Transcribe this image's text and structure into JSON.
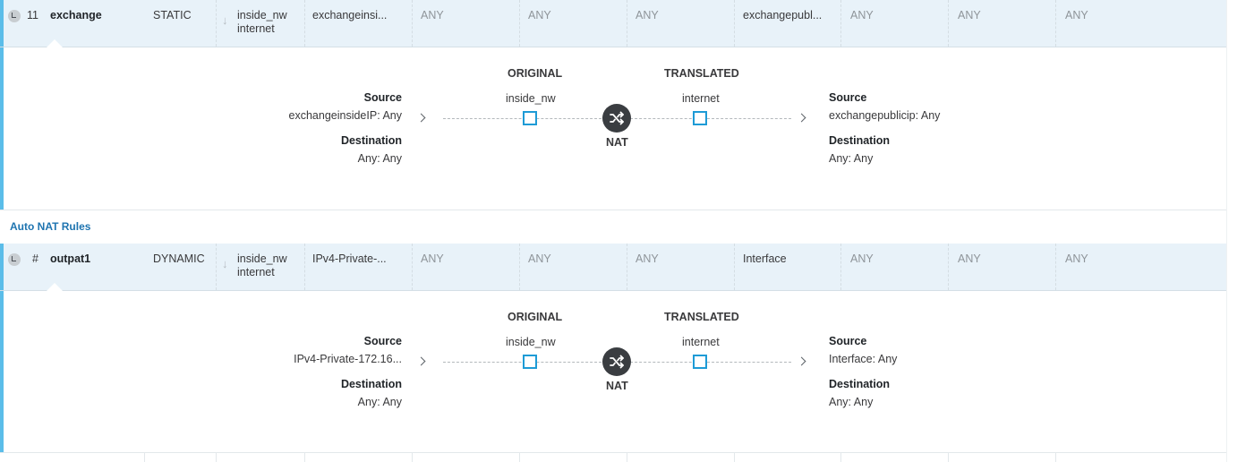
{
  "rules": [
    {
      "number": "11",
      "name": "exchange",
      "type": "STATIC",
      "interfaces": {
        "source": "inside_nw",
        "destination": "internet"
      },
      "columns": [
        "exchangeinsi...",
        "ANY",
        "ANY",
        "ANY",
        "exchangepubl...",
        "ANY",
        "ANY",
        "ANY"
      ],
      "detail": {
        "original_header": "ORIGINAL",
        "translated_header": "TRANSLATED",
        "original_interface": "inside_nw",
        "translated_interface": "internet",
        "nat_label": "NAT",
        "left": {
          "source_label": "Source",
          "source_value": "exchangeinsideIP: Any",
          "destination_label": "Destination",
          "destination_value": "Any: Any"
        },
        "right": {
          "source_label": "Source",
          "source_value": "exchangepublicip: Any",
          "destination_label": "Destination",
          "destination_value": "Any: Any"
        }
      }
    },
    {
      "number": "#",
      "name": "outpat1",
      "type": "DYNAMIC",
      "interfaces": {
        "source": "inside_nw",
        "destination": "internet"
      },
      "columns": [
        "IPv4-Private-...",
        "ANY",
        "ANY",
        "ANY",
        "Interface",
        "ANY",
        "ANY",
        "ANY"
      ],
      "detail": {
        "original_header": "ORIGINAL",
        "translated_header": "TRANSLATED",
        "original_interface": "inside_nw",
        "translated_interface": "internet",
        "nat_label": "NAT",
        "left": {
          "source_label": "Source",
          "source_value": "IPv4-Private-172.16...",
          "destination_label": "Destination",
          "destination_value": "Any: Any"
        },
        "right": {
          "source_label": "Source",
          "source_value": "Interface: Any",
          "destination_label": "Destination",
          "destination_value": "Any: Any"
        }
      }
    }
  ],
  "section": {
    "auto_nat_title": "Auto NAT Rules"
  },
  "icons": {
    "expand": "collapse-toggle-icon",
    "arrow": "down-arrow-icon",
    "chevron": "chevron-right-icon",
    "nat": "shuffle-icon",
    "node": "interface-node-icon"
  },
  "colors": {
    "accent": "#5bbde9",
    "row_bg": "#e8f2f9",
    "link": "#1e74b0",
    "node": "#1e9bd6",
    "nat_bg": "#3a3d41"
  }
}
